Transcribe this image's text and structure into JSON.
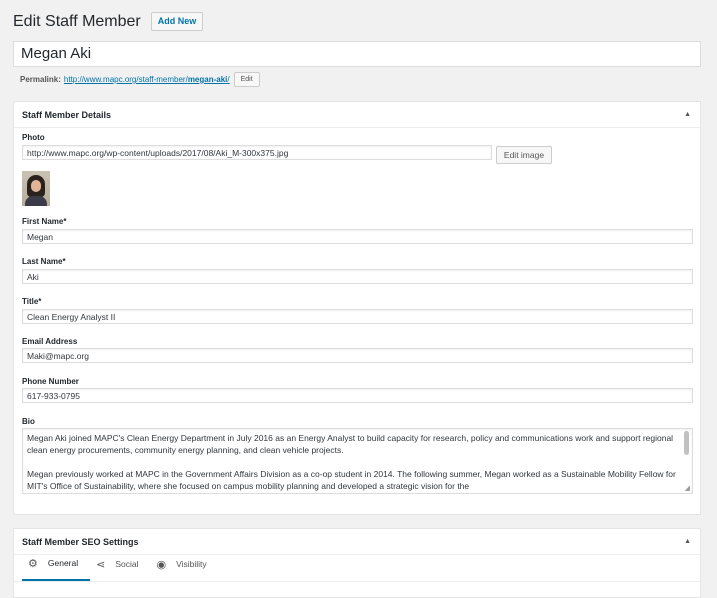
{
  "header": {
    "title": "Edit Staff Member",
    "add_new": "Add New"
  },
  "post_title": "Megan Aki",
  "permalink": {
    "label": "Permalink:",
    "url_base": "http://www.mapc.org/staff-member/",
    "slug": "megan-aki",
    "url_end": "/",
    "edit": "Edit"
  },
  "details": {
    "title": "Staff Member Details",
    "photo": {
      "label": "Photo",
      "value": "http://www.mapc.org/wp-content/uploads/2017/08/Aki_M-300x375.jpg",
      "edit_image": "Edit image"
    },
    "first_name": {
      "label": "First Name*",
      "value": "Megan"
    },
    "last_name": {
      "label": "Last Name*",
      "value": "Aki"
    },
    "job_title": {
      "label": "Title*",
      "value": "Clean Energy Analyst II"
    },
    "email": {
      "label": "Email Address",
      "value": "Maki@mapc.org"
    },
    "phone": {
      "label": "Phone Number",
      "value": "617-933-0795"
    },
    "bio": {
      "label": "Bio",
      "paragraphs": [
        "Megan Aki joined MAPC's Clean Energy Department in July 2016 as an Energy Analyst to build capacity for research, policy and communications work and support regional clean energy procurements, community energy planning, and clean vehicle projects.",
        "Megan previously worked at MAPC in the Government Affairs Division as a co-op student in 2014. The following summer, Megan worked as a Sustainable Mobility Fellow for MIT's Office of Sustainability, where she focused on campus mobility planning and developed a strategic vision for the"
      ]
    }
  },
  "seo": {
    "title": "Staff Member SEO Settings",
    "tabs": [
      {
        "label": "General",
        "icon": "gear-icon"
      },
      {
        "label": "Social",
        "icon": "share-icon"
      },
      {
        "label": "Visibility",
        "icon": "eye-icon"
      }
    ]
  },
  "colors": {
    "link": "#0073aa",
    "background": "#f1f1f1"
  }
}
